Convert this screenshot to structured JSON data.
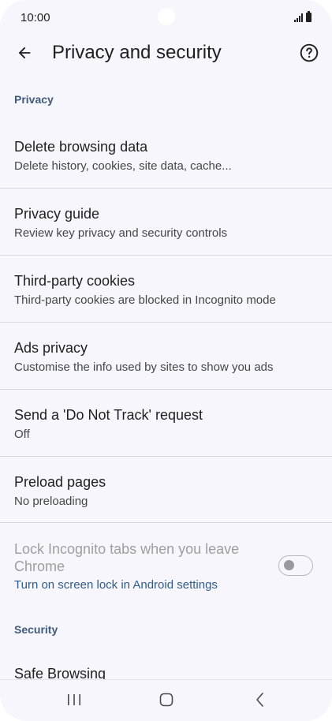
{
  "status_bar": {
    "time": "10:00"
  },
  "header": {
    "title": "Privacy and security",
    "back_icon": "arrow-back-icon",
    "help_icon": "help-icon"
  },
  "sections": {
    "privacy": "Privacy",
    "security": "Security"
  },
  "items": [
    {
      "title": "Delete browsing data",
      "summary": "Delete history, cookies, site data, cache..."
    },
    {
      "title": "Privacy guide",
      "summary": "Review key privacy and security controls"
    },
    {
      "title": "Third-party cookies",
      "summary": "Third-party cookies are blocked in Incognito mode"
    },
    {
      "title": "Ads privacy",
      "summary": "Customise the info used by sites to show you ads"
    },
    {
      "title": "Send a 'Do Not Track' request",
      "summary": "Off"
    },
    {
      "title": "Preload pages",
      "summary": "No preloading"
    }
  ],
  "lock_incognito": {
    "title": "Lock Incognito tabs when you leave Chrome",
    "link": "Turn on screen lock in Android settings",
    "enabled": false,
    "checked": false
  },
  "security_items": [
    {
      "title": "Safe Browsing"
    }
  ],
  "nav": {
    "recents_icon": "recents-icon",
    "home_icon": "home-icon",
    "back_icon": "nav-back-icon"
  },
  "colors": {
    "background": "#f7f6fc",
    "section_header": "#405a7c",
    "link": "#2f5c8a",
    "disabled_text": "#9e9e9e"
  }
}
